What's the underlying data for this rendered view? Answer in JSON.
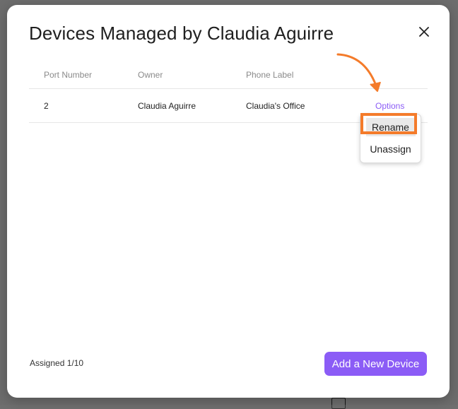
{
  "modal": {
    "title": "Devices Managed by Claudia Aguirre",
    "close_icon": "close-icon"
  },
  "table": {
    "headers": [
      "Port Number",
      "Owner",
      "Phone Label",
      ""
    ],
    "rows": [
      {
        "port": "2",
        "owner": "Claudia Aguirre",
        "phone_label": "Claudia's Office",
        "action": "Options"
      }
    ]
  },
  "options_menu": {
    "items": [
      "Rename",
      "Unassign"
    ],
    "highlighted_item": "Rename",
    "highlight_color": "#f47b2a"
  },
  "footer": {
    "assigned_text": "Assigned 1/10",
    "add_button_label": "Add a New Device"
  },
  "colors": {
    "accent": "#8b5cf6",
    "annotation": "#f47b2a"
  }
}
